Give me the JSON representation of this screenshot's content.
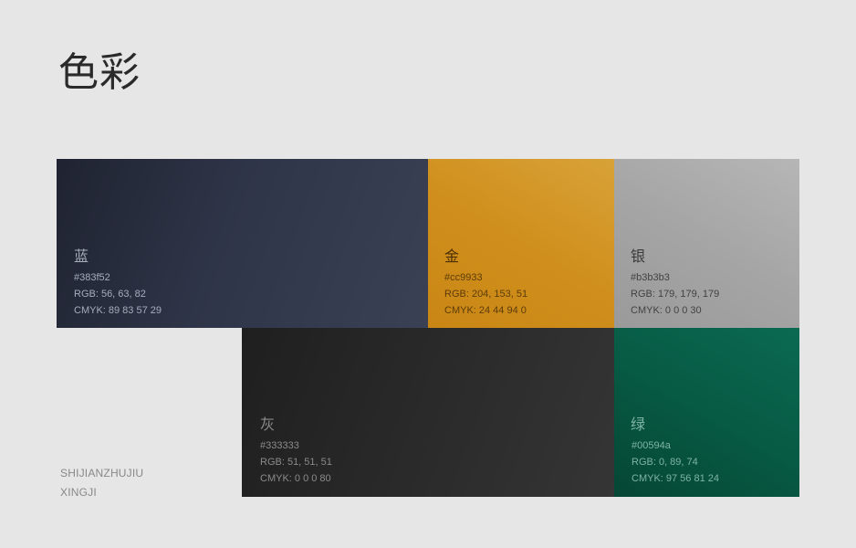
{
  "page": {
    "title": "色彩"
  },
  "swatches": [
    {
      "name": "蓝",
      "hex": "#383f52",
      "rgb": "RGB: 56, 63, 82",
      "cmyk": "CMYK: 89 83 57 29",
      "color": "#383f52"
    },
    {
      "name": "金",
      "hex": "#cc9933",
      "rgb": "RGB: 204, 153, 51",
      "cmyk": "CMYK: 24 44 94 0",
      "color": "#cc9933"
    },
    {
      "name": "银",
      "hex": "#b3b3b3",
      "rgb": "RGB: 179, 179, 179",
      "cmyk": "CMYK: 0 0 0 30",
      "color": "#b3b3b3"
    },
    {
      "name": "灰",
      "hex": "#333333",
      "rgb": "RGB: 51, 51, 51",
      "cmyk": "CMYK: 0 0 0 80",
      "color": "#333333"
    },
    {
      "name": "绿",
      "hex": "#00594a",
      "rgb": "RGB: 0, 89, 74",
      "cmyk": "CMYK: 97 56 81 24",
      "color": "#00594a"
    }
  ],
  "footer": {
    "line1": "SHIJIANZHUJIU",
    "line2": "XINGJI"
  }
}
